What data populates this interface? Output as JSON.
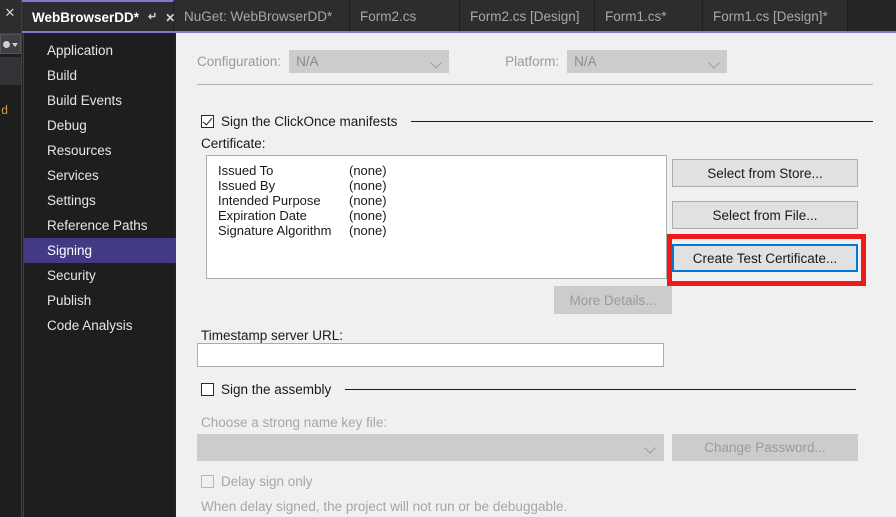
{
  "window": {
    "theme_accent": "#8772d6",
    "panel_bg": "#f0f0f0",
    "selection_purple": "#433a85",
    "annotation_color": "#ee1b1b",
    "focus_blue": "#0078d7"
  },
  "left_sliver": {
    "close_icon": "✕",
    "text_fragment": "d"
  },
  "tabs": [
    {
      "label": "WebBrowserDD*",
      "active": true,
      "pin_icon": "⚔",
      "close_icon": "✕"
    },
    {
      "label": "NuGet: WebBrowserDD*",
      "active": false
    },
    {
      "label": "Form2.cs",
      "active": false
    },
    {
      "label": "Form2.cs [Design]",
      "active": false
    },
    {
      "label": "Form1.cs*",
      "active": false
    },
    {
      "label": "Form1.cs [Design]*",
      "active": false
    }
  ],
  "sidebar": {
    "items": [
      {
        "label": "Application",
        "selected": false
      },
      {
        "label": "Build",
        "selected": false
      },
      {
        "label": "Build Events",
        "selected": false
      },
      {
        "label": "Debug",
        "selected": false
      },
      {
        "label": "Resources",
        "selected": false
      },
      {
        "label": "Services",
        "selected": false
      },
      {
        "label": "Settings",
        "selected": false
      },
      {
        "label": "Reference Paths",
        "selected": false
      },
      {
        "label": "Signing",
        "selected": true
      },
      {
        "label": "Security",
        "selected": false
      },
      {
        "label": "Publish",
        "selected": false
      },
      {
        "label": "Code Analysis",
        "selected": false
      }
    ]
  },
  "main": {
    "configuration": {
      "label": "Configuration:",
      "value": "N/A",
      "enabled": false
    },
    "platform": {
      "label": "Platform:",
      "value": "N/A",
      "enabled": false
    },
    "sign_manifests": {
      "label": "Sign the ClickOnce manifests",
      "checked": true
    },
    "certificate": {
      "label": "Certificate:",
      "rows": [
        {
          "key": "Issued To",
          "value": "(none)"
        },
        {
          "key": "Issued By",
          "value": "(none)"
        },
        {
          "key": "Intended Purpose",
          "value": "(none)"
        },
        {
          "key": "Expiration Date",
          "value": "(none)"
        },
        {
          "key": "Signature Algorithm",
          "value": "(none)"
        }
      ]
    },
    "buttons": {
      "select_from_store": "Select from Store...",
      "select_from_file": "Select from File...",
      "create_test_certificate": "Create Test Certificate...",
      "more_details": "More Details...",
      "change_password": "Change Password..."
    },
    "timestamp": {
      "label": "Timestamp server URL:",
      "value": "",
      "placeholder": ""
    },
    "sign_assembly": {
      "label": "Sign the assembly",
      "checked": false
    },
    "key_file": {
      "label": "Choose a strong name key file:",
      "value": "",
      "enabled": false
    },
    "delay_sign": {
      "label": "Delay sign only",
      "checked": false,
      "note": "When delay signed, the project will not run or be debuggable."
    }
  }
}
